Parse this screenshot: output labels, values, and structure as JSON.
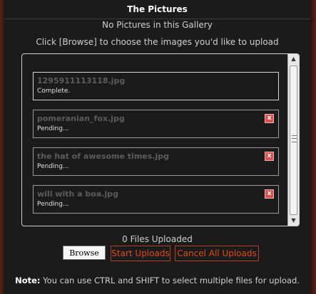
{
  "header": {
    "title": "The Pictures"
  },
  "gallery": {
    "empty_text": "No Pictures in this Gallery",
    "instructions": "Click [Browse] to choose the images you'd like to upload"
  },
  "queue": {
    "files": [
      {
        "name": "1295911113118.jpg",
        "status": "Complete.",
        "cancel_icon": "x"
      },
      {
        "name": "pomeranian_fox.jpg",
        "status": "Pending...",
        "cancel_icon": "x"
      },
      {
        "name": "the hat of awesome times.jpg",
        "status": "Pending...",
        "cancel_icon": "x"
      },
      {
        "name": "will with a boa.jpg",
        "status": "Pending...",
        "cancel_icon": "x"
      }
    ]
  },
  "footer": {
    "files_uploaded": "0 Files Uploaded",
    "browse_label": "Browse",
    "start_label": "Start Uploads",
    "cancel_all_label": "Cancel All Uploads",
    "note_label": "Note:",
    "note_text": " You can use CTRL and SHIFT to select multiple files for upload."
  },
  "colors": {
    "panel_bg": "#1b1b1b",
    "accent_red": "#e04a1b",
    "cancel_icon_red": "#d9534f"
  }
}
